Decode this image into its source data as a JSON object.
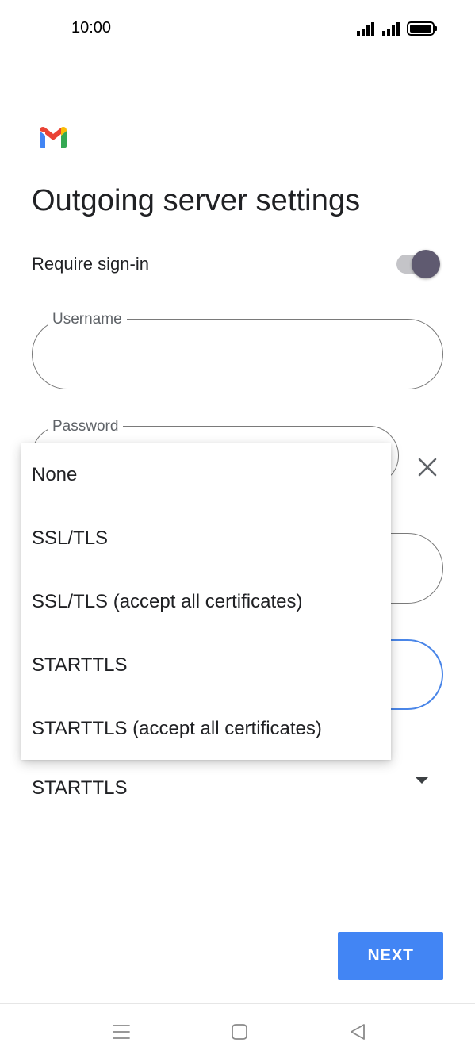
{
  "status_bar": {
    "time": "10:00",
    "icons": [
      "signal-icon",
      "signal-icon",
      "battery-icon"
    ]
  },
  "app": {
    "logo_icon": "gmail-logo-icon",
    "title": "Outgoing server settings"
  },
  "require_signin": {
    "label": "Require sign-in",
    "enabled": true
  },
  "fields": {
    "username": {
      "label": "Username",
      "value": ""
    },
    "password": {
      "label": "Password",
      "value": ""
    }
  },
  "security": {
    "selected": "STARTTLS",
    "options": [
      "None",
      "SSL/TLS",
      "SSL/TLS (accept all certificates)",
      "STARTTLS",
      "STARTTLS (accept all certificates)"
    ]
  },
  "actions": {
    "next_label": "NEXT"
  },
  "colors": {
    "accent": "#4285f4",
    "toggle_thumb": "#5f5a70",
    "toggle_track": "#c4c4c8",
    "text": "#202124"
  },
  "nav_bar": {
    "icons": [
      "menu-icon",
      "home-icon",
      "back-icon"
    ]
  }
}
